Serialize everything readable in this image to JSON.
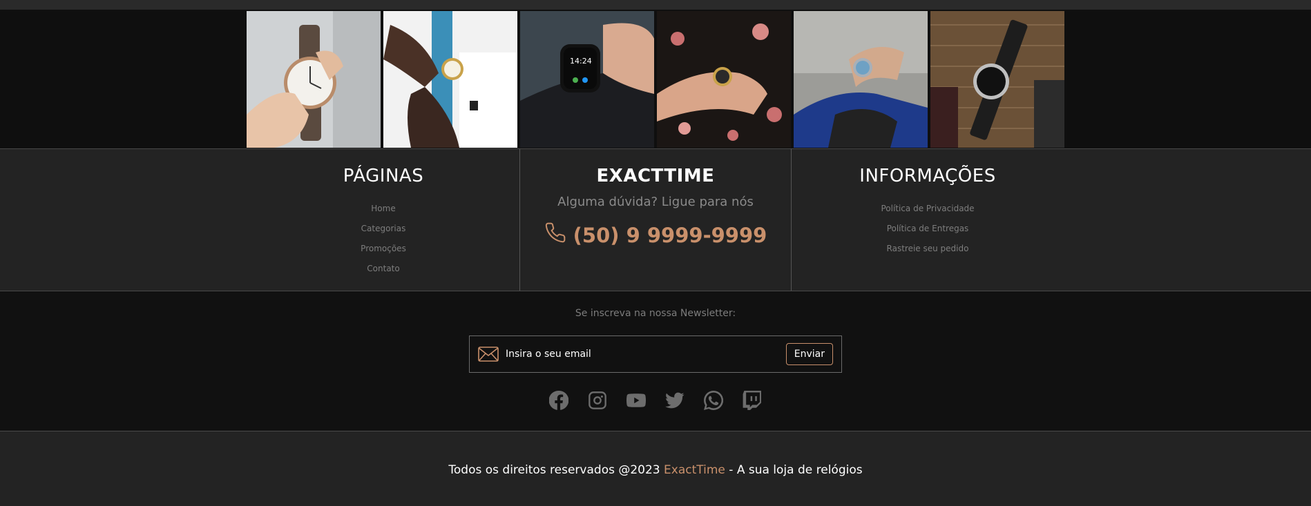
{
  "gallery": {
    "photos": [
      {
        "icon": "watch-photo-hand"
      },
      {
        "icon": "watch-photo-cuff"
      },
      {
        "icon": "watch-photo-smartwatch"
      },
      {
        "icon": "watch-photo-floral"
      },
      {
        "icon": "watch-photo-suit"
      },
      {
        "icon": "watch-photo-flatlay"
      }
    ]
  },
  "pages": {
    "title": "PÁGINAS",
    "links": [
      "Home",
      "Categorias",
      "Promoções",
      "Contato"
    ]
  },
  "brand": {
    "title": "EXACTTIME",
    "ask": "Alguma dúvida? Ligue para nós",
    "phone": "(50) 9 9999-9999",
    "phone_icon": "phone-icon",
    "accent_color": "#c9906b"
  },
  "informacoes": {
    "title": "INFORMAÇÕES",
    "links": [
      "Política de Privacidade",
      "Política de Entregas",
      "Rastreie seu pedido"
    ]
  },
  "newsletter": {
    "label": "Se inscreva na nossa Newsletter:",
    "placeholder": "Insira o seu email",
    "button": "Enviar",
    "icon": "envelope-icon"
  },
  "socials": [
    "facebook-icon",
    "instagram-icon",
    "youtube-icon",
    "twitter-icon",
    "whatsapp-icon",
    "twitch-icon"
  ],
  "footer": {
    "prefix": "Todos os direitos reservados @2023 ",
    "brand": "ExactTime",
    "suffix": " - A sua loja de relógios"
  }
}
